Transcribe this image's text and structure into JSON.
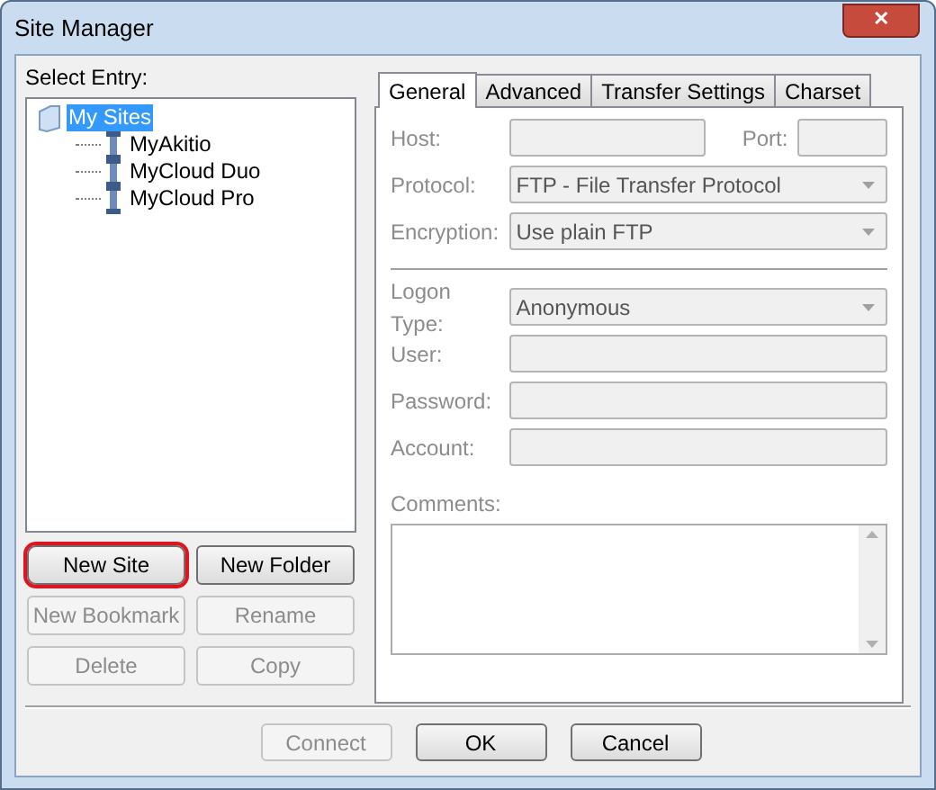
{
  "window": {
    "title": "Site Manager",
    "close": "✕"
  },
  "select_entry": {
    "label": "Select Entry:"
  },
  "tree": [
    {
      "label": "My Sites",
      "selected": true,
      "kind": "folder",
      "children": [
        {
          "label": "MyAkitio",
          "selected": false,
          "kind": "site"
        },
        {
          "label": "MyCloud Duo",
          "selected": false,
          "kind": "site"
        },
        {
          "label": "MyCloud Pro",
          "selected": false,
          "kind": "site"
        }
      ]
    }
  ],
  "entry_buttons": [
    {
      "label": "New Site",
      "disabled": false,
      "highlighted": true
    },
    {
      "label": "New Folder",
      "disabled": false,
      "highlighted": false
    },
    {
      "label": "New Bookmark",
      "disabled": true,
      "highlighted": false
    },
    {
      "label": "Rename",
      "disabled": true,
      "highlighted": false
    },
    {
      "label": "Delete",
      "disabled": true,
      "highlighted": false
    },
    {
      "label": "Copy",
      "disabled": true,
      "highlighted": false
    }
  ],
  "tabs": [
    {
      "label": "General",
      "selected": true
    },
    {
      "label": "Advanced",
      "selected": false
    },
    {
      "label": "Transfer Settings",
      "selected": false
    },
    {
      "label": "Charset",
      "selected": false
    }
  ],
  "host": {
    "label": "Host:",
    "disabled": true
  },
  "port": {
    "label": "Port:",
    "disabled": true
  },
  "fields": [
    {
      "label": "Protocol:",
      "kind": "select",
      "value": "FTP - File Transfer Protocol",
      "disabled": true
    },
    {
      "label": "Encryption:",
      "kind": "select",
      "value": "Use plain FTP",
      "disabled": true
    },
    {
      "kind": "separator"
    },
    {
      "label": "Logon Type:",
      "kind": "select",
      "value": "Anonymous",
      "disabled": true
    },
    {
      "label": "User:",
      "kind": "input",
      "disabled": true
    },
    {
      "label": "Password:",
      "kind": "input",
      "disabled": true
    },
    {
      "label": "Account:",
      "kind": "input",
      "disabled": true
    }
  ],
  "comments": {
    "label": "Comments:",
    "disabled": true
  },
  "dialog_buttons": [
    {
      "label": "Connect",
      "disabled": true
    },
    {
      "label": "OK",
      "disabled": false
    },
    {
      "label": "Cancel",
      "disabled": false
    }
  ]
}
